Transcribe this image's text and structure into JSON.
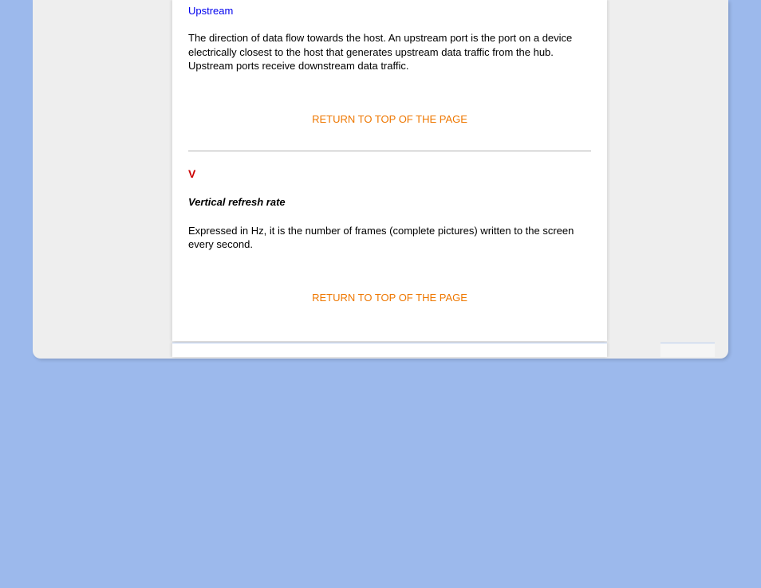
{
  "glossary": {
    "upstream": {
      "title": "Upstream",
      "body": "The direction of data flow towards the host. An upstream port is the port on a device electrically closest to the host that generates upstream data traffic from the hub. Upstream ports receive downstream data traffic."
    },
    "return_link_1": "RETURN TO TOP OF THE PAGE",
    "section_v": {
      "letter": "V",
      "term_title": "Vertical refresh rate",
      "term_body": "Expressed in Hz, it is the number of frames (complete pictures) written to the screen every second."
    },
    "return_link_2": "RETURN TO TOP OF THE PAGE"
  }
}
